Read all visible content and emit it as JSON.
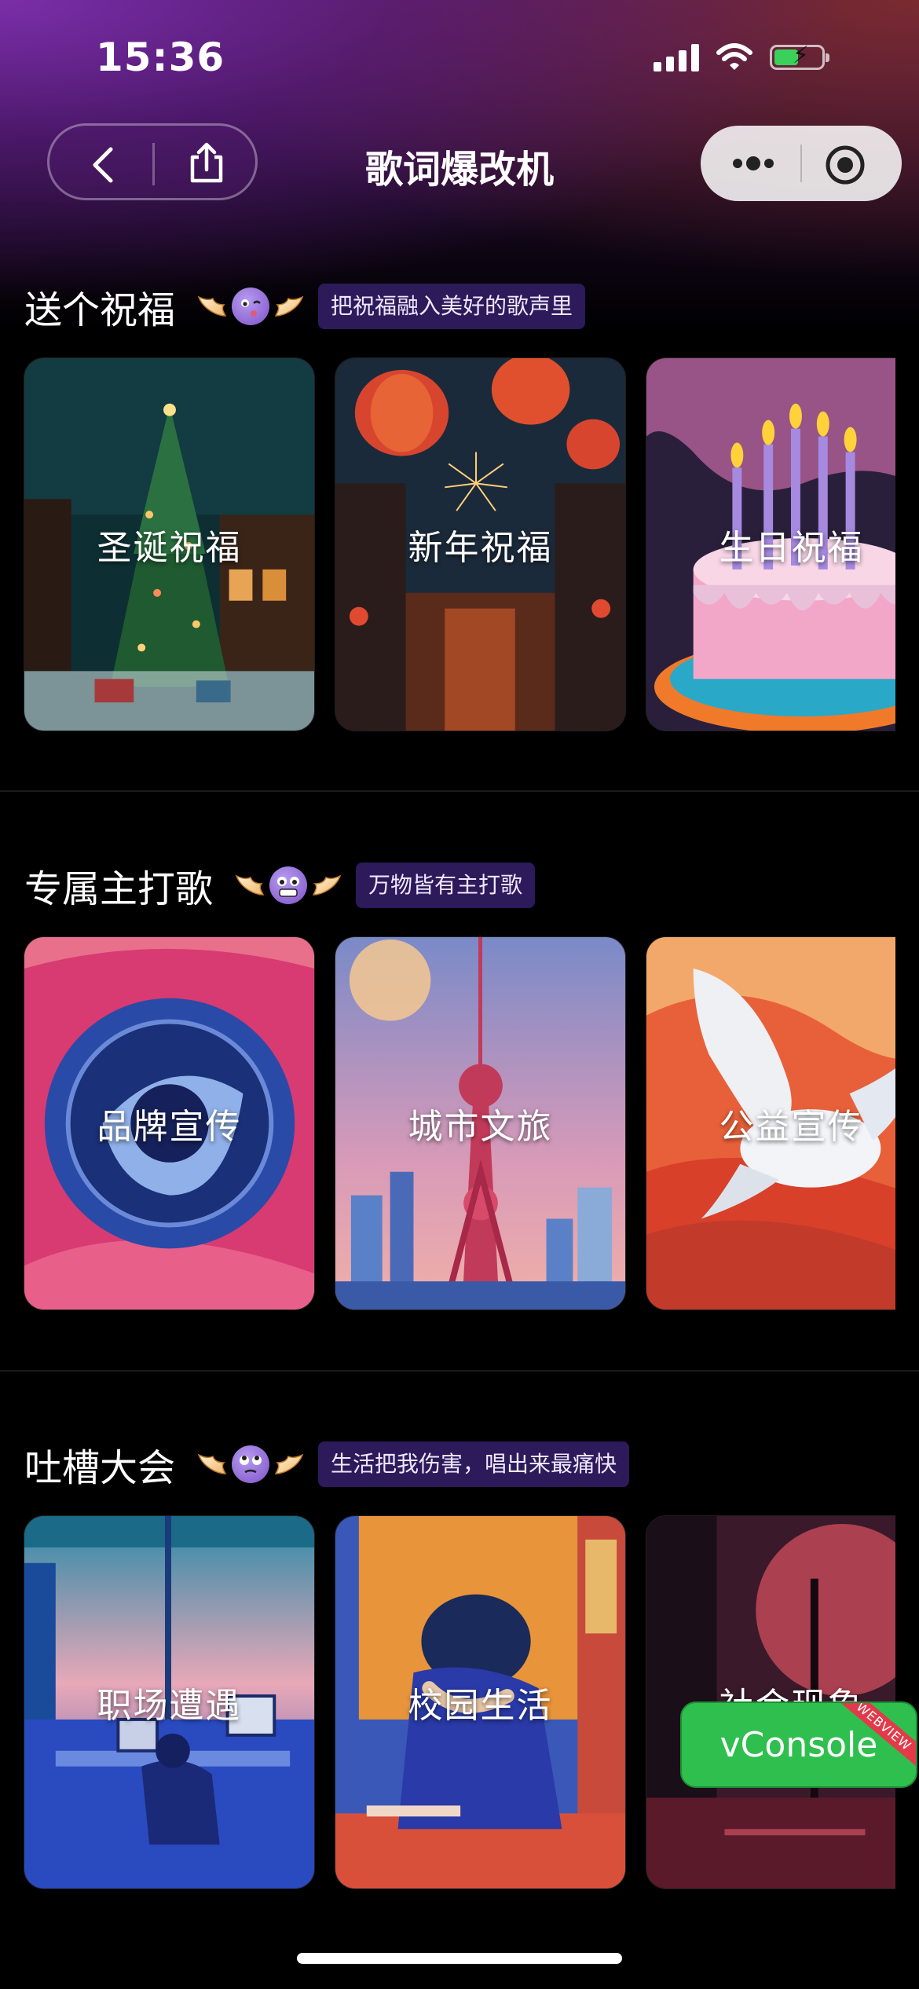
{
  "status_bar": {
    "time": "15:36"
  },
  "nav": {
    "title": "歌词爆改机"
  },
  "sections": [
    {
      "title": "送个祝福",
      "tag": "把祝福融入美好的歌声里",
      "cards": [
        {
          "label": "圣诞祝福"
        },
        {
          "label": "新年祝福"
        },
        {
          "label": "生日祝福"
        }
      ]
    },
    {
      "title": "专属主打歌",
      "tag": "万物皆有主打歌",
      "cards": [
        {
          "label": "品牌宣传"
        },
        {
          "label": "城市文旅"
        },
        {
          "label": "公益宣传"
        }
      ]
    },
    {
      "title": "吐槽大会",
      "tag": "生活把我伤害，唱出来最痛快",
      "cards": [
        {
          "label": "职场遭遇"
        },
        {
          "label": "校园生活"
        },
        {
          "label": "社会现象"
        }
      ]
    }
  ],
  "vconsole": {
    "label": "vConsole",
    "ribbon": "WEBVIEW"
  },
  "colors": {
    "tag_bg": "#2c1a5a",
    "vconsole_green": "#2fbf4e"
  },
  "icons": [
    "back-arrow-icon",
    "share-icon",
    "more-dots-icon",
    "close-mini-program-icon",
    "signal-icon",
    "wifi-icon",
    "battery-charging-icon"
  ]
}
